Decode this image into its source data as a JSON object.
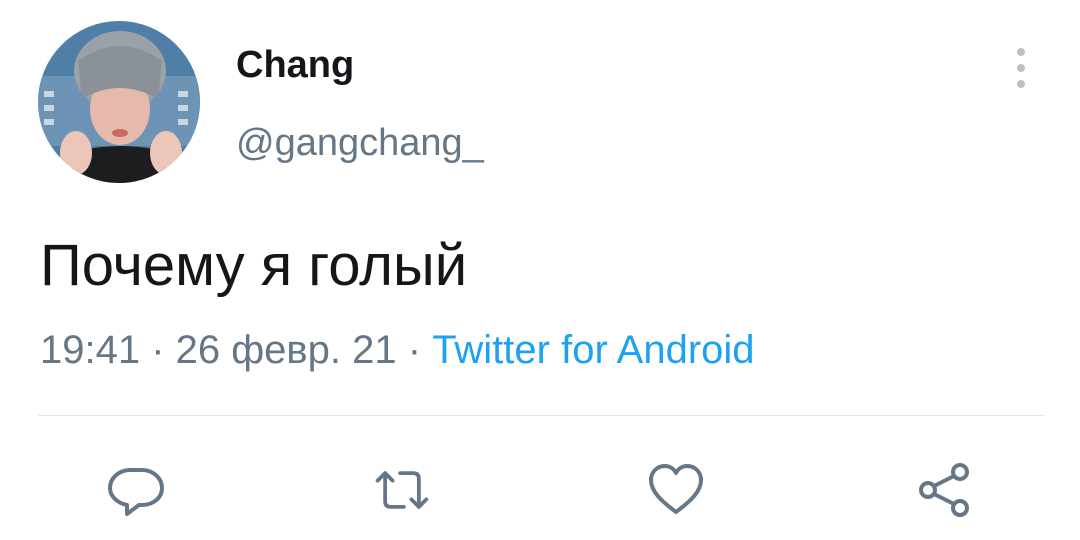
{
  "tweet": {
    "author": {
      "display_name": "Chang",
      "handle": "@gangchang_"
    },
    "text": "Почему я голый",
    "time": "19:41",
    "date": "26 февр. 21",
    "source": "Twitter for Android",
    "separator": " · "
  },
  "icons": {
    "more": "more-vertical-icon",
    "reply": "reply-icon",
    "retweet": "retweet-icon",
    "like": "heart-icon",
    "share": "share-icon"
  },
  "colors": {
    "text": "#14171a",
    "secondary": "#657786",
    "accent": "#1da1f2",
    "divider": "#e1e8ed",
    "icon": "#657786"
  }
}
